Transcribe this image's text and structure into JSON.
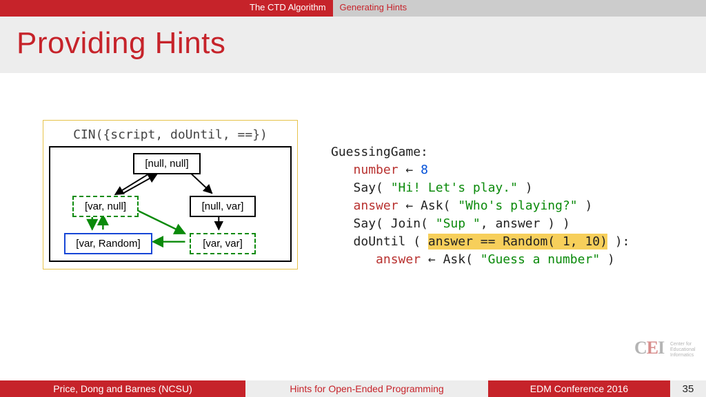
{
  "topnav": {
    "active": "The CTD Algorithm",
    "inactive": "Generating Hints"
  },
  "title": "Providing Hints",
  "diagram": {
    "caption": "CIN({script, doUntil, ==})",
    "nodes": {
      "top": "[null, null]",
      "vnull": "[var, null]",
      "nvar": "[null, var]",
      "vrand": "[var, Random]",
      "vvar": "[var, var]"
    }
  },
  "code": {
    "l1": "GuessingGame:",
    "l2a": "number",
    "l2b": " ← ",
    "l2c": "8",
    "l3a": "Say( ",
    "l3b": "\"Hi! Let's play.\"",
    "l3c": " )",
    "l4a": "answer",
    "l4b": " ← Ask( ",
    "l4c": "\"Who's playing?\"",
    "l4d": " )",
    "l5a": "Say( Join( ",
    "l5b": "\"Sup \"",
    "l5c": ", answer ) )",
    "l6a": "doUntil ( ",
    "l6b": "answer == Random( 1, 10)",
    "l6c": " ):",
    "l7a": "answer",
    "l7b": " ← Ask( ",
    "l7c": "\"Guess a number\"",
    "l7d": " )"
  },
  "footer": {
    "authors": "Price, Dong and Barnes (NCSU)",
    "center": "Hints for Open-Ended Programming",
    "venue": "EDM Conference 2016",
    "page": "35"
  },
  "logo": {
    "text": "CEI",
    "sub1": "Center for",
    "sub2": "Educational",
    "sub3": "Informatics"
  }
}
